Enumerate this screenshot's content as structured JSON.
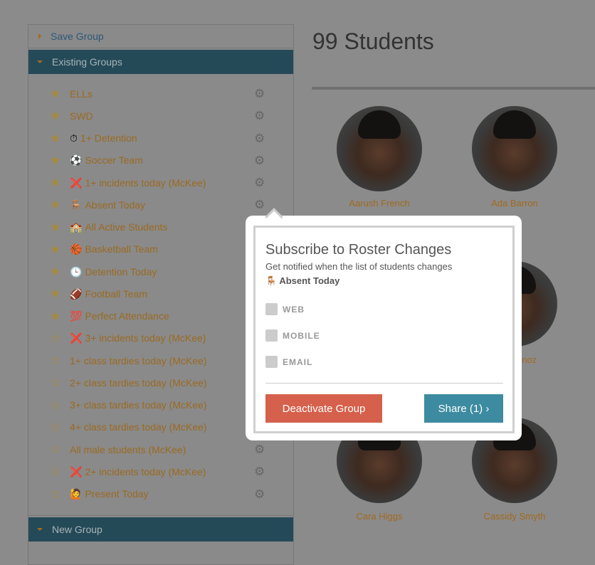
{
  "sidebar": {
    "save_group": "Save Group",
    "existing_groups": "Existing Groups",
    "new_group": "New Group",
    "groups": [
      {
        "emoji": "",
        "label": "ELLs",
        "starred": true,
        "gear": true
      },
      {
        "emoji": "",
        "label": "SWD",
        "starred": true,
        "gear": true
      },
      {
        "emoji": "⏱",
        "label": "1+ Detention",
        "starred": true,
        "gear": true
      },
      {
        "emoji": "⚽",
        "label": "Soccer Team",
        "starred": true,
        "gear": true
      },
      {
        "emoji": "❌",
        "label": "1+ incidents today (McKee)",
        "starred": true,
        "gear": true
      },
      {
        "emoji": "🪑",
        "label": "Absent Today",
        "starred": true,
        "gear": true
      },
      {
        "emoji": "🏫",
        "label": "All Active Students",
        "starred": true,
        "gear": false
      },
      {
        "emoji": "🏀",
        "label": "Basketball Team",
        "starred": true,
        "gear": false
      },
      {
        "emoji": "🕒",
        "label": "Detention Today",
        "starred": true,
        "gear": false
      },
      {
        "emoji": "🏈",
        "label": "Football Team",
        "starred": true,
        "gear": false
      },
      {
        "emoji": "💯",
        "label": "Perfect Attendance",
        "starred": true,
        "gear": false
      },
      {
        "emoji": "❌",
        "label": "3+ incidents today (McKee)",
        "starred": false,
        "gear": false
      },
      {
        "emoji": "",
        "label": "1+ class tardies today (McKee)",
        "starred": false,
        "gear": false
      },
      {
        "emoji": "",
        "label": "2+ class tardies today (McKee)",
        "starred": false,
        "gear": false
      },
      {
        "emoji": "",
        "label": "3+ class tardies today (McKee)",
        "starred": false,
        "gear": false
      },
      {
        "emoji": "",
        "label": "4+ class tardies today (McKee)",
        "starred": false,
        "gear": false
      },
      {
        "emoji": "",
        "label": "All male students (McKee)",
        "starred": false,
        "gear": true
      },
      {
        "emoji": "❌",
        "label": "2+ incidents today (McKee)",
        "starred": false,
        "gear": true
      },
      {
        "emoji": "🙋",
        "label": "Present Today",
        "starred": false,
        "gear": true
      }
    ]
  },
  "main": {
    "title": "99 Students",
    "students": [
      "Aarush French",
      "Ada Barron",
      "unoz",
      "Cara Higgs",
      "Cassidy Smyth"
    ]
  },
  "popup": {
    "title": "Subscribe to Roster Changes",
    "subtitle": "Get notified when the list of students changes",
    "group_emoji": "🪑",
    "group_name": "Absent Today",
    "options": [
      {
        "label": "WEB",
        "checked": false
      },
      {
        "label": "MOBILE",
        "checked": false
      },
      {
        "label": "EMAIL",
        "checked": false
      }
    ],
    "deactivate_label": "Deactivate Group",
    "share_label": "Share (1) ›"
  },
  "colors": {
    "header": "#244a58",
    "deactivate": "#d5604c",
    "share": "#3d8ba0",
    "link": "#9a6a22"
  }
}
